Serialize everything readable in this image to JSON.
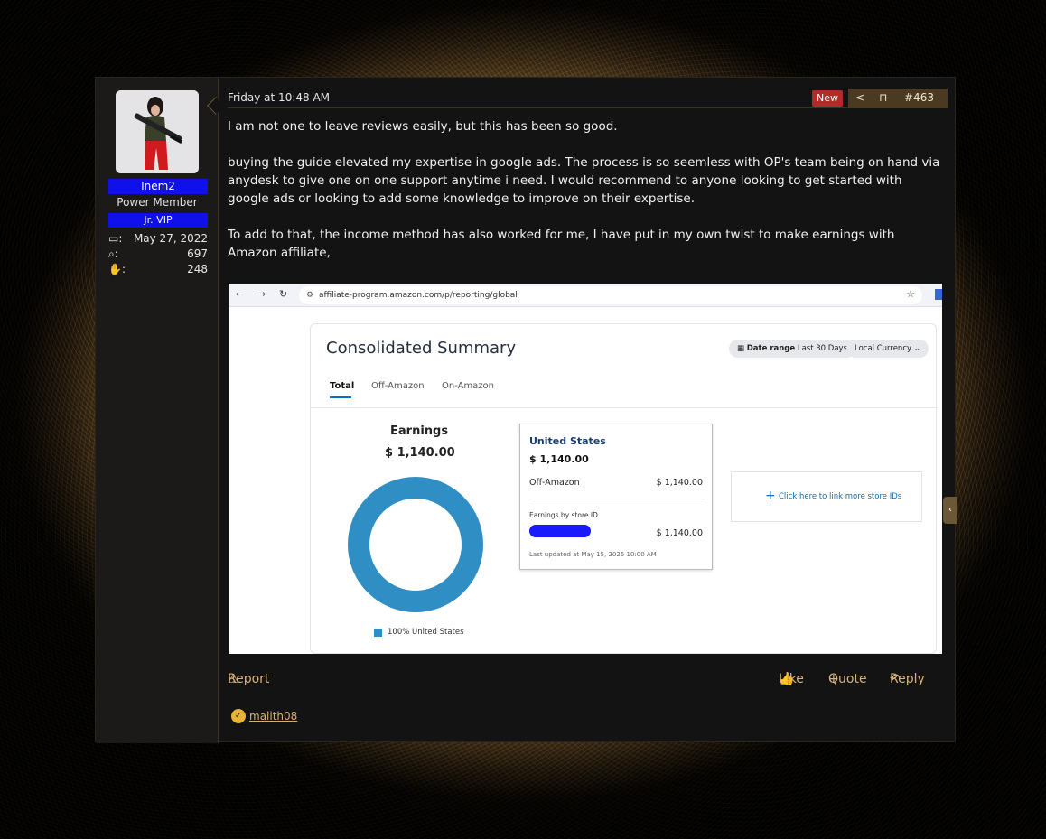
{
  "user": {
    "username": "Inem2",
    "title": "Power Member",
    "banner": "Jr. VIP",
    "stats": [
      {
        "icon": "calendar-icon",
        "glyph": "🗓",
        "value": "May 27, 2022"
      },
      {
        "icon": "messages-icon",
        "glyph": "🗨",
        "value": "697"
      },
      {
        "icon": "reaction-score-icon",
        "glyph": "👍",
        "value": "248"
      }
    ]
  },
  "post": {
    "date": "Friday at 10:48 AM",
    "new_badge": "New",
    "number": "#463",
    "paragraphs": [
      "I am not one to leave reviews easily, but this has been so good.",
      "buying the guide elevated my expertise in google ads. The process is so seemless with OP's team being on hand via anydesk to give one on one support anytime i need. I would recommend to anyone looking to get started with google ads or looking to add some knowledge to improve on their expertise.",
      "To add to that, the income method has also worked for me, I have put in my own twist to make earnings with Amazon affiliate,"
    ]
  },
  "screenshot": {
    "url": "affiliate-program.amazon.com/p/reporting/global",
    "card_title": "Consolidated Summary",
    "date_range_label": "Date range",
    "date_range_value": "Last 30 Days",
    "currency": "Local Currency",
    "tabs": [
      "Total",
      "Off-Amazon",
      "On-Amazon"
    ],
    "earnings_title": "Earnings",
    "earnings_amount": "$ 1,140.00",
    "legend": "100% United States",
    "country": "United States",
    "country_amount": "$ 1,140.00",
    "off_amazon_label": "Off-Amazon",
    "off_amazon_value": "$ 1,140.00",
    "store_label": "Earnings by store ID",
    "store_value": "$ 1,140.00",
    "last_updated": "Last updated at May 15, 2025 10:00 AM",
    "link_store": "Click here to link more store IDs",
    "donut_share_us": 1.0,
    "accent_color": "#2f8fc4"
  },
  "actions": {
    "report": "Report",
    "like": "Like",
    "quote": "Quote",
    "reply": "Reply"
  },
  "reactions": {
    "users": "malith08"
  },
  "colors": {
    "accent": "#d9b27a",
    "badge_blue": "#1010e8",
    "new_badge": "#b32a2a"
  }
}
